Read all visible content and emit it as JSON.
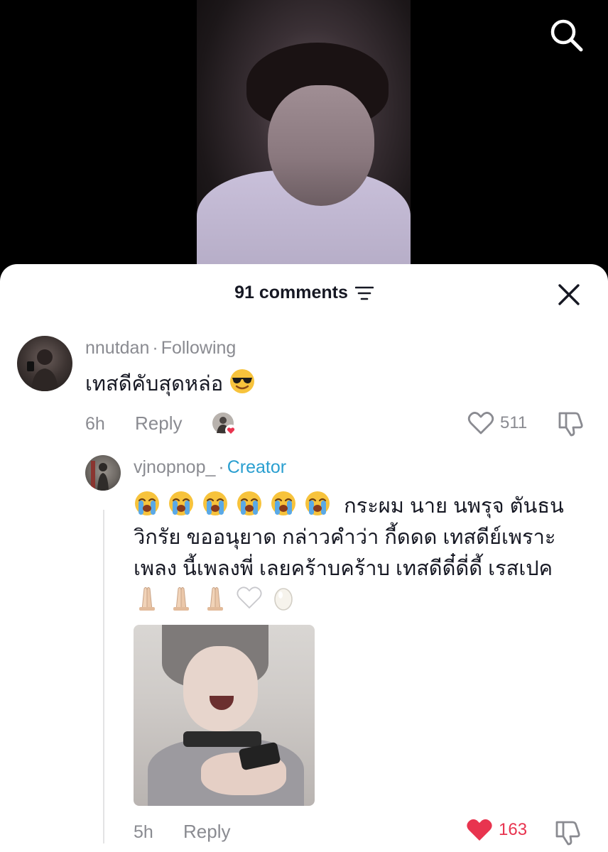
{
  "header": {
    "comments_count": "91 comments"
  },
  "comments": [
    {
      "username": "nnutdan",
      "badge": "Following",
      "text": "เทสดีคับสุดหล่อ",
      "text_emoji": "sunglasses-emoji",
      "time": "6h",
      "reply_label": "Reply",
      "likes": "511",
      "liked": false
    },
    {
      "username": "vjnopnop_",
      "badge": "Creator",
      "text": "กระผม นาย นพรุจ ตันธนวิกรัย ขออนุยาด กล่าวคำว่า กี้ดดด เทสดีย์เพราะเพลง นี้เพลงพี่ เลยคร้าบคร้าบ เทสดีดี๋ดี่ดี้ เรสเปค",
      "leading_emojis": [
        "loudly-crying-emoji",
        "loudly-crying-emoji",
        "loudly-crying-emoji",
        "loudly-crying-emoji",
        "loudly-crying-emoji",
        "loudly-crying-emoji"
      ],
      "trailing_emojis": [
        "folded-hands-emoji",
        "folded-hands-emoji",
        "folded-hands-emoji",
        "white-heart-emoji",
        "egg-emoji"
      ],
      "time": "5h",
      "reply_label": "Reply",
      "likes": "163",
      "liked": true
    }
  ],
  "colors": {
    "creator_badge": "#2a9fd0",
    "liked_heart": "#e8344f",
    "muted_text": "#8a8b91",
    "primary_text": "#161823"
  }
}
